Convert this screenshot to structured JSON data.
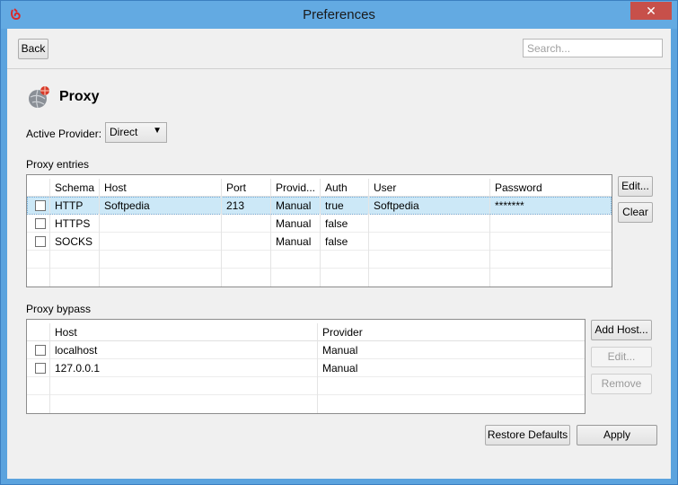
{
  "window": {
    "title": "Preferences",
    "close_glyph": "✕"
  },
  "toolbar": {
    "back_label": "Back",
    "search_placeholder": "Search..."
  },
  "page": {
    "title": "Proxy",
    "active_provider_label": "Active Provider:",
    "active_provider_value": "Direct",
    "proxy_entries_label": "Proxy entries",
    "proxy_bypass_label": "Proxy bypass"
  },
  "entries": {
    "columns": [
      "Schema",
      "Host",
      "Port",
      "Provid...",
      "Auth",
      "User",
      "Password"
    ],
    "rows": [
      {
        "schema": "HTTP",
        "host": "Softpedia",
        "port": "213",
        "provider": "Manual",
        "auth": "true",
        "user": "Softpedia",
        "password": "*******"
      },
      {
        "schema": "HTTPS",
        "host": "",
        "port": "",
        "provider": "Manual",
        "auth": "false",
        "user": "",
        "password": ""
      },
      {
        "schema": "SOCKS",
        "host": "",
        "port": "",
        "provider": "Manual",
        "auth": "false",
        "user": "",
        "password": ""
      }
    ],
    "edit_label": "Edit...",
    "clear_label": "Clear"
  },
  "bypass": {
    "columns": [
      "Host",
      "Provider"
    ],
    "rows": [
      {
        "host": "localhost",
        "provider": "Manual"
      },
      {
        "host": "127.0.0.1",
        "provider": "Manual"
      }
    ],
    "add_host_label": "Add Host...",
    "edit_label": "Edit...",
    "remove_label": "Remove"
  },
  "footer": {
    "restore_label": "Restore Defaults",
    "apply_label": "Apply"
  },
  "colors": {
    "titlebar": "#63aae2",
    "selection": "#cce8f7",
    "close": "#c7504a"
  }
}
